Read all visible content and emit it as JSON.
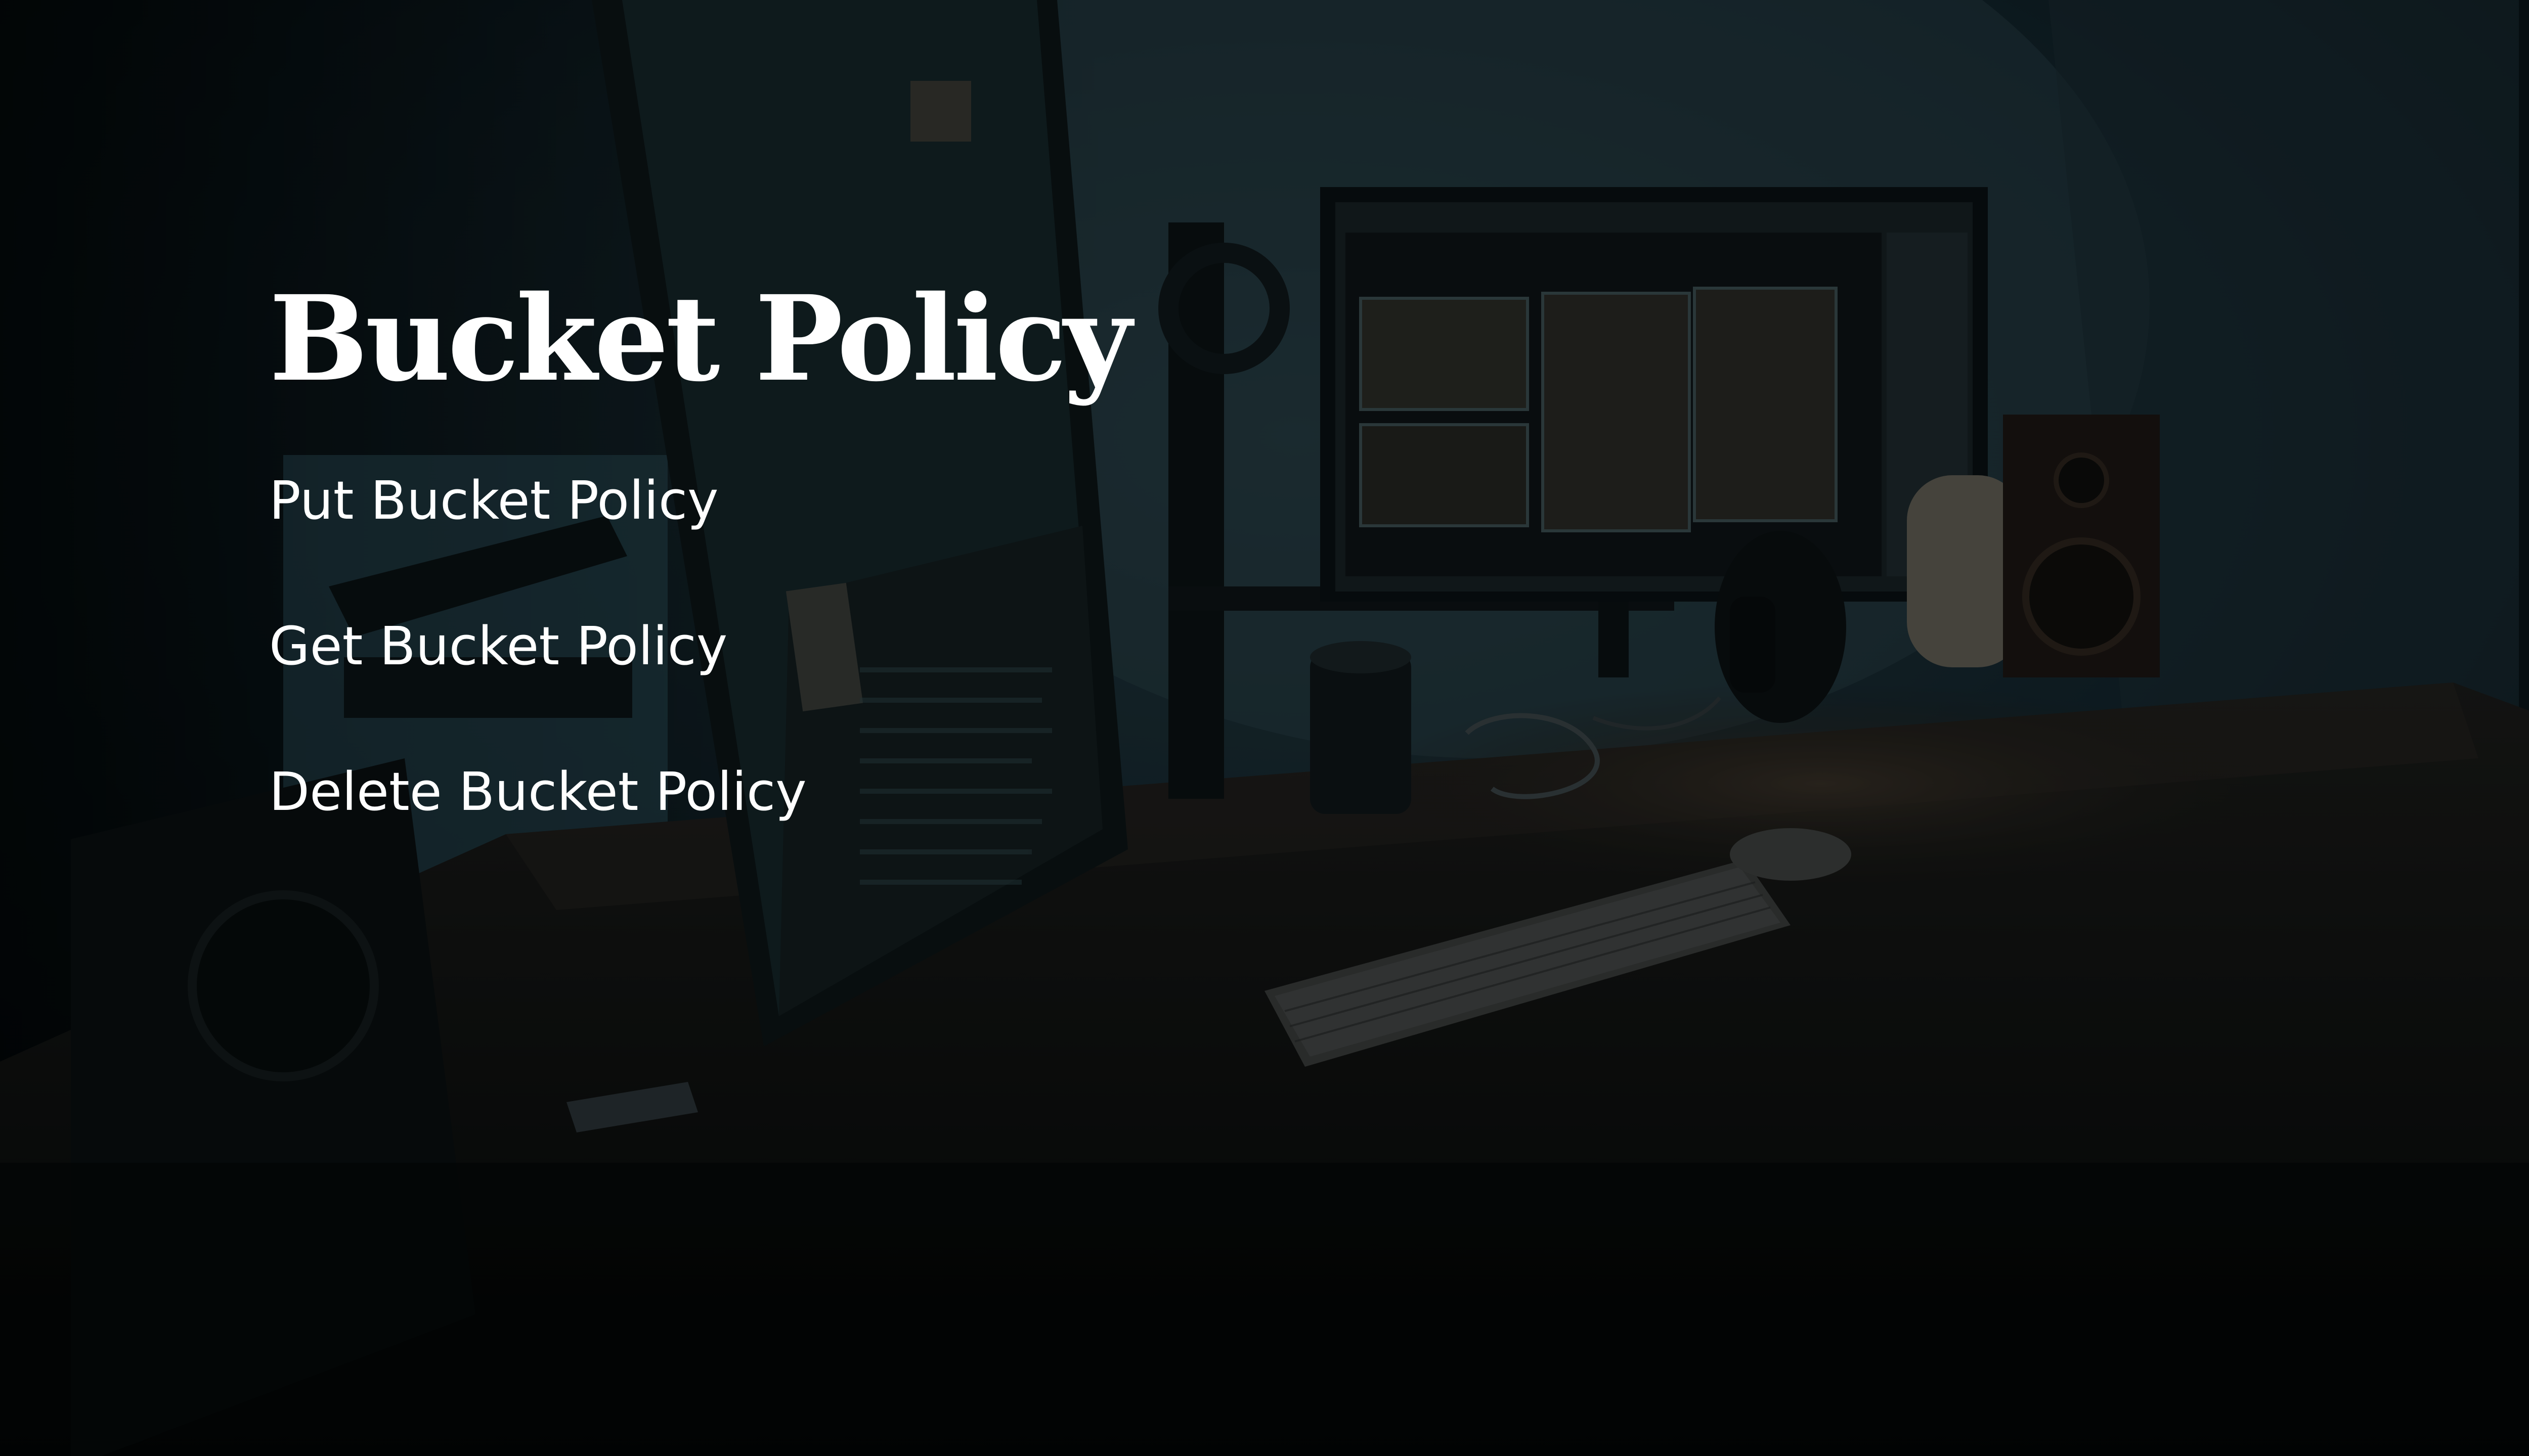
{
  "slide": {
    "title": "Bucket Policy",
    "links": [
      {
        "label": "Put Bucket Policy"
      },
      {
        "label": "Get Bucket Policy"
      },
      {
        "label": "Delete Bucket Policy"
      }
    ]
  },
  "colors": {
    "background": "#05090b",
    "text": "#ffffff"
  }
}
